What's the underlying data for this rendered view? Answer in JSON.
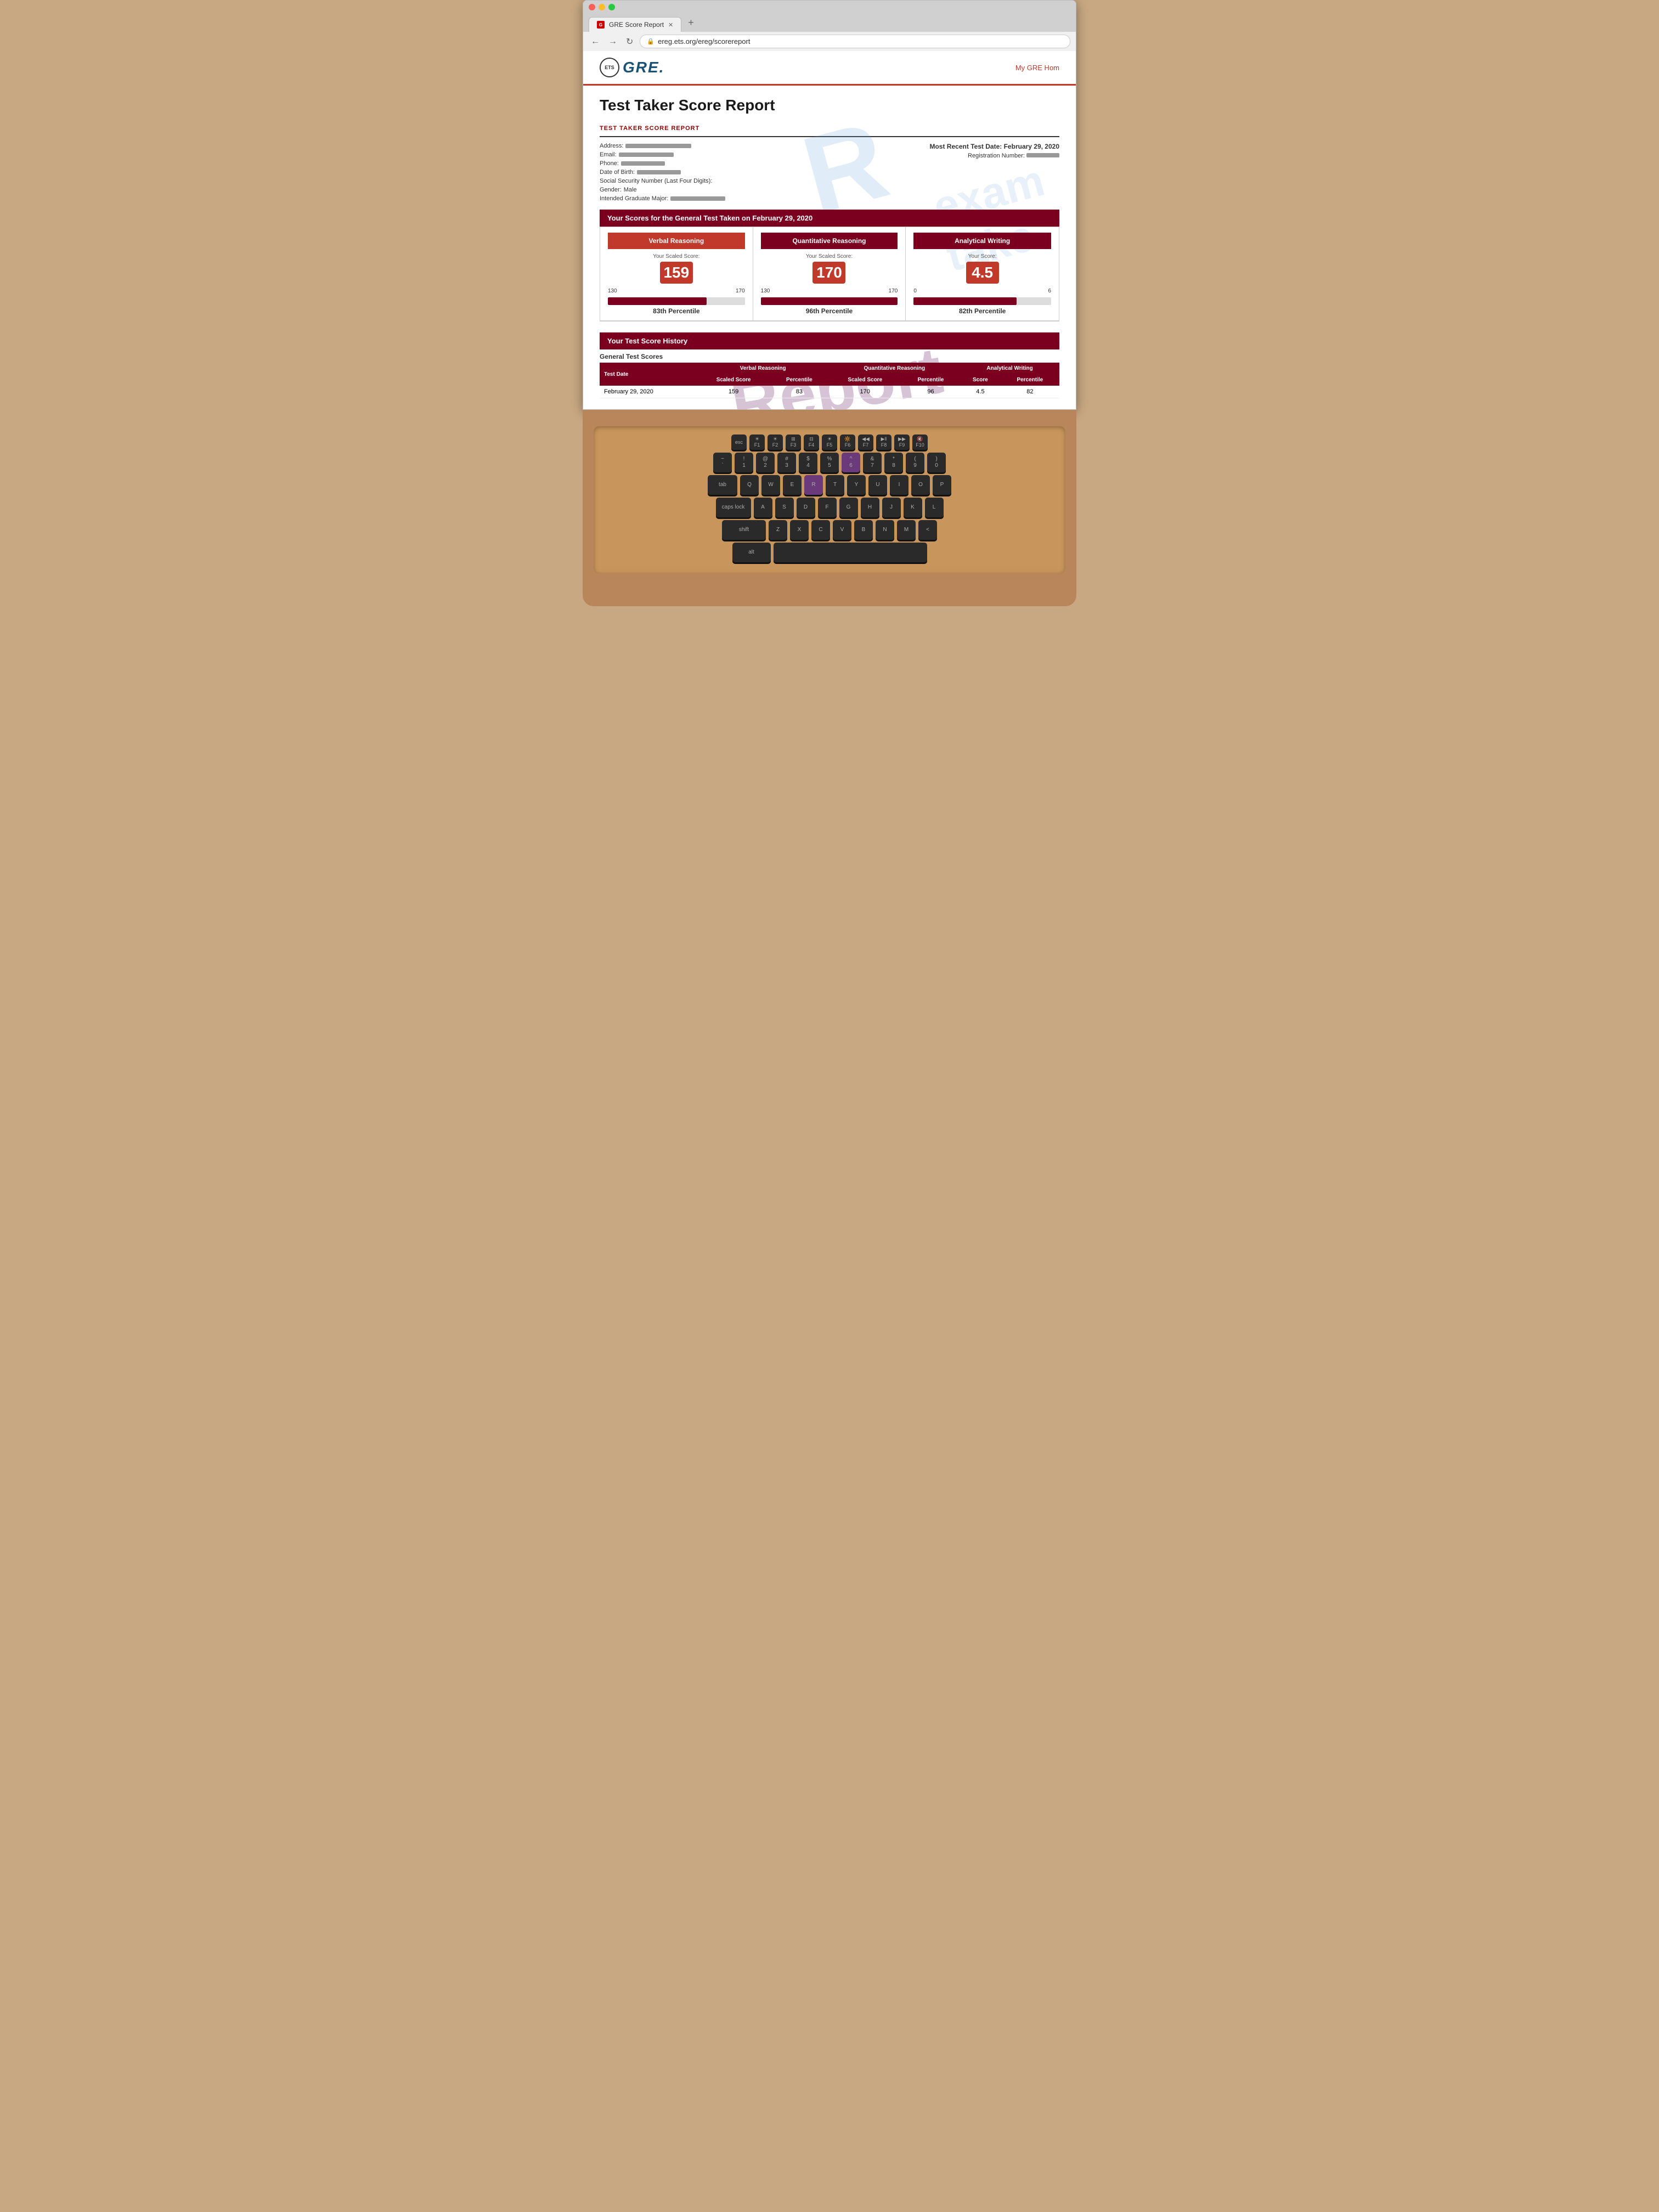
{
  "browser": {
    "tab_title": "GRE Score Report",
    "tab_favicon": "G",
    "url": "ereg.ets.org/ereg/scorereport",
    "new_tab": "+"
  },
  "gre": {
    "ets_label": "ETS",
    "gre_label": "GRE.",
    "nav_right": "My GRE Hom",
    "watermark": "R",
    "watermark2": "exam"
  },
  "header": {
    "title": "Test Taker Score Report"
  },
  "report": {
    "section_title": "TEST TAKER SCORE REPORT",
    "most_recent": "Most Recent Test Date: February 29, 2020",
    "reg_label": "Registration Number:",
    "address_label": "Address:",
    "email_label": "Email:",
    "phone_label": "Phone:",
    "dob_label": "Date of Birth:",
    "ssn_label": "Social Security Number (Last Four Digits):",
    "gender_label": "Gender:",
    "gender_value": "Male",
    "major_label": "Intended Graduate Major:"
  },
  "scores_section": {
    "header": "Your Scores for the General Test Taken on February 29, 2020",
    "verbal": {
      "title": "Verbal Reasoning",
      "scaled_label": "Your Scaled Score:",
      "score": "159",
      "range_low": "130",
      "range_high": "170",
      "percentile": "83th Percentile",
      "bar_pct": 72
    },
    "quant": {
      "title": "Quantitative Reasoning",
      "scaled_label": "Your Scaled Score:",
      "score": "170",
      "range_low": "130",
      "range_high": "170",
      "percentile": "96th Percentile",
      "bar_pct": 100
    },
    "writing": {
      "title": "Analytical Writing",
      "score_label": "Your Score:",
      "score": "4.5",
      "range_low": "0",
      "range_high": "6",
      "percentile": "82th Percentile",
      "bar_pct": 75
    }
  },
  "history": {
    "header": "Your Test Score History",
    "sub": "General Test Scores",
    "col_test_date": "Test Date",
    "col_verbal_scaled": "Scaled Score",
    "col_verbal_pct": "Percentile",
    "col_quant_scaled": "Scaled Score",
    "col_quant_pct": "Percentile",
    "col_writing_score": "Score",
    "col_writing_pct": "Percentile",
    "col_verbal": "Verbal Reasoning",
    "col_quant": "Quantitative Reasoning",
    "col_writing": "Analytical Writing",
    "rows": [
      {
        "date": "February 29, 2020",
        "verbal_scaled": "159",
        "verbal_pct": "83",
        "quant_scaled": "170",
        "quant_pct": "96",
        "writing_score": "4.5",
        "writing_pct": "82"
      }
    ]
  },
  "keyboard": {
    "rows": [
      [
        "esc",
        "F1",
        "F2",
        "F3",
        "F4",
        "F5",
        "F6",
        "F7",
        "F8",
        "F9",
        "F10"
      ],
      [
        "~\n`",
        "!\n1",
        "@\n2",
        "#\n3",
        "$\n4",
        "%\n5",
        "^\n6",
        "&\n7",
        "*\n8",
        "(\n9",
        ")\n0"
      ],
      [
        "tab",
        "Q",
        "W",
        "E",
        "R",
        "T",
        "Y",
        "U",
        "I",
        "O",
        "P"
      ],
      [
        "caps lock",
        "A",
        "S",
        "D",
        "F",
        "G",
        "H",
        "J",
        "K",
        "L"
      ],
      [
        "shift",
        "Z",
        "X",
        "C",
        "V",
        "B",
        "N",
        "M",
        "<"
      ],
      [
        "alt",
        ""
      ]
    ]
  }
}
